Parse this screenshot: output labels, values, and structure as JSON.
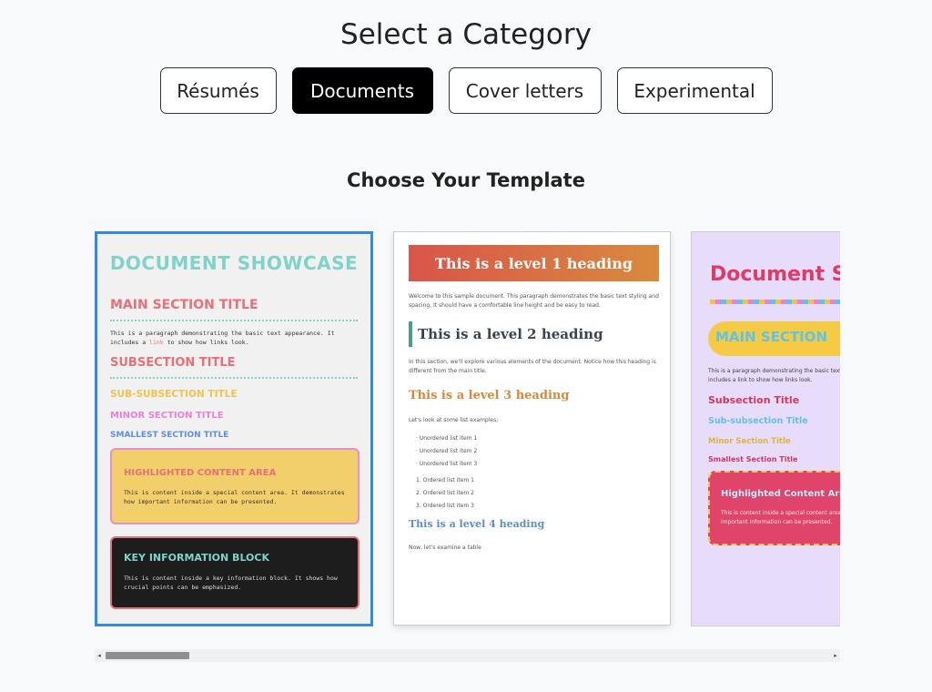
{
  "header": {
    "title": "Select a Category"
  },
  "categories": [
    {
      "label": "Résumés",
      "active": false
    },
    {
      "label": "Documents",
      "active": true
    },
    {
      "label": "Cover letters",
      "active": false
    },
    {
      "label": "Experimental",
      "active": false
    }
  ],
  "template_section": {
    "title": "Choose Your Template"
  },
  "templates": [
    {
      "selected": true,
      "title": "DOCUMENT SHOWCASE",
      "main_section": "MAIN SECTION TITLE",
      "paragraph_pre": "This is a paragraph demonstrating the basic text appearance. It includes a ",
      "link": "link",
      "paragraph_post": " to show how links look.",
      "subsection": "SUBSECTION TITLE",
      "subsubsection": "SUB-SUBSECTION TITLE",
      "minor": "MINOR SECTION TITLE",
      "smallest": "SMALLEST SECTION TITLE",
      "highlight_title": "HIGHLIGHTED CONTENT AREA",
      "highlight_text": "This is content inside a special content area. It demonstrates how important information can be presented.",
      "key_title": "KEY INFORMATION BLOCK",
      "key_text": "This is content inside a key information block. It shows how crucial points can be emphasized."
    },
    {
      "selected": false,
      "h1": "This is a level 1 heading",
      "intro": "Welcome to this sample document. This paragraph demonstrates the basic text styling and spacing. It should have a comfortable line height and be easy to read.",
      "h2": "This is a level 2 heading",
      "h2_text": "In this section, we'll explore various elements of the document. Notice how this heading is different from the main title.",
      "h3": "This is a level 3 heading",
      "list_intro": "Let's look at some list examples:",
      "unordered": [
        "Unordered list item 1",
        "Unordered list item 2",
        "Unordered list item 3"
      ],
      "ordered": [
        "1.  Ordered list item 1",
        "2.  Ordered list item 2",
        "3.  Ordered list item 3"
      ],
      "h4": "This is a level 4 heading",
      "table_intro": "Now, let's examine a table"
    },
    {
      "selected": false,
      "title": "Document S",
      "main_section": "MAIN SECTION",
      "paragraph": "This is a paragraph demonstrating the basic text appearance. It includes a link to show how links look.",
      "subsection": "Subsection Title",
      "subsubsection": "Sub-subsection Title",
      "minor": "Minor Section Title",
      "smallest": "Smallest Section Title",
      "highlight_title": "Highlighted Content Area",
      "highlight_text": "This is content inside a special content area. It demonstrates how important information can be presented."
    }
  ],
  "scrollbar": {
    "left_arrow": "◂",
    "right_arrow": "▸"
  }
}
